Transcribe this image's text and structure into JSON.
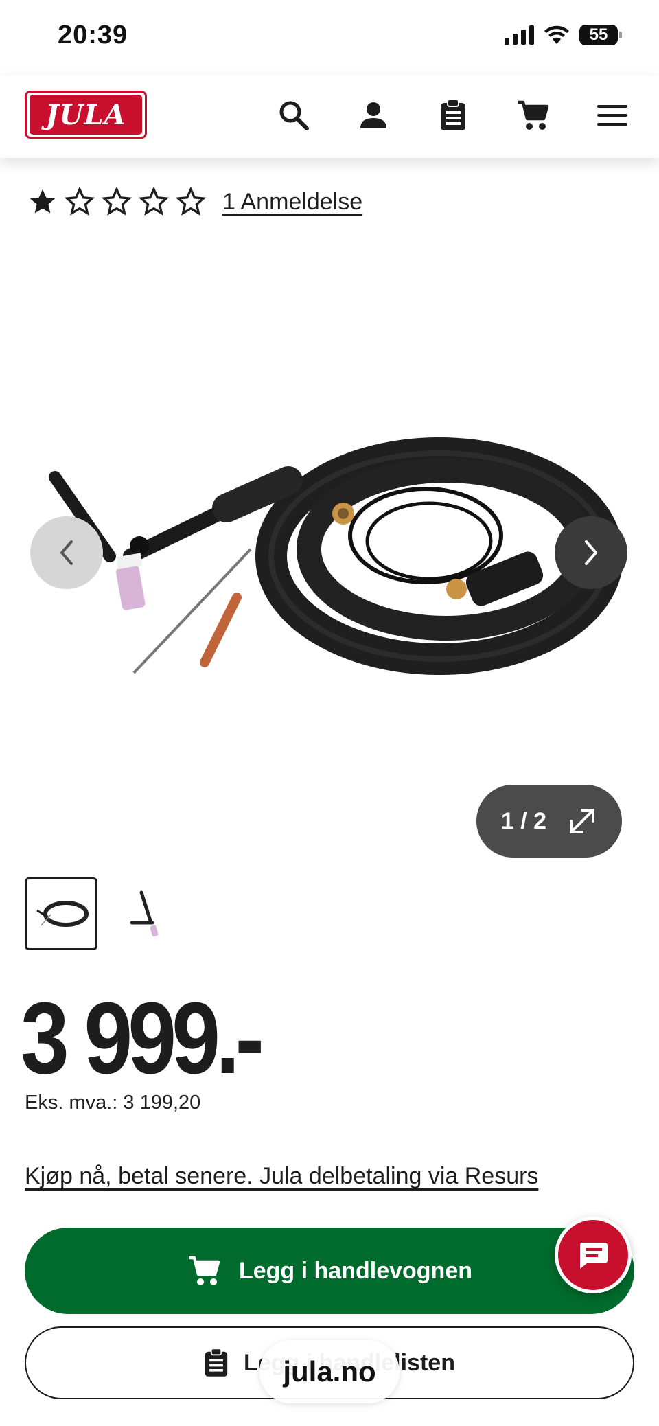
{
  "status_bar": {
    "time": "20:39",
    "battery": "55"
  },
  "header": {
    "logo_text": "JULA",
    "icons": [
      "search-icon",
      "user-icon",
      "clipboard-icon",
      "cart-icon",
      "menu-icon"
    ]
  },
  "rating": {
    "filled_stars": 1,
    "max_stars": 5,
    "review_link": "1 Anmeldelse"
  },
  "gallery": {
    "counter": "1 / 2"
  },
  "price": {
    "amount": "3 999.-",
    "ex_vat": "Eks. mva.: 3 199,20"
  },
  "finance_link": "Kjøp nå, betal senere. Jula delbetaling via Resurs",
  "buttons": {
    "add_to_cart": "Legg i handlevognen",
    "add_to_list": "Legg i handlelisten"
  },
  "browser": {
    "url": "jula.no"
  },
  "colors": {
    "brand_red": "#c8102e",
    "cart_green": "#006b2c"
  }
}
